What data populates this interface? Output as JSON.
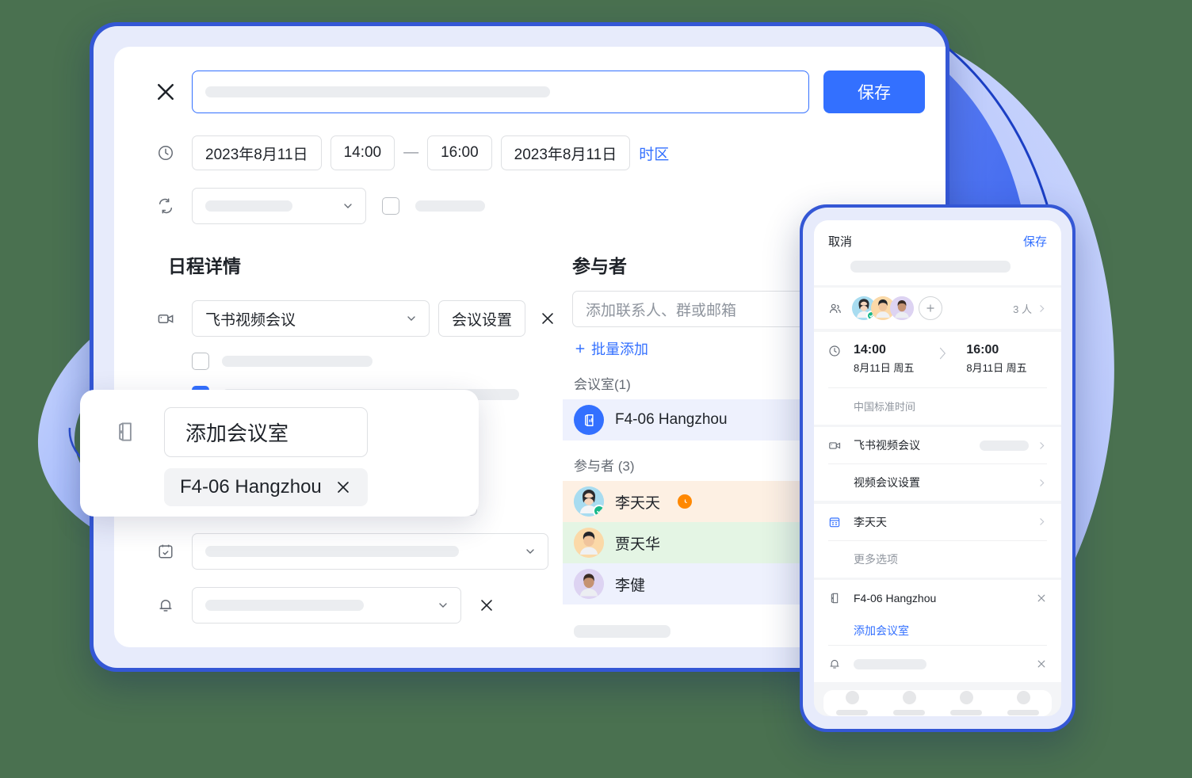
{
  "background_color": "#4a7150",
  "accent_color": "#3370ff",
  "device_frame_color": "#3457d5",
  "tablet": {
    "close_icon": "close-icon",
    "title_placeholder": "",
    "save_label": "保存",
    "datetime": {
      "clock_icon": "clock-icon",
      "start_date": "2023年8月11日",
      "start_time": "14:00",
      "separator": "—",
      "end_time": "16:00",
      "end_date": "2023年8月11日",
      "timezone_label": "时区"
    },
    "repeat": {
      "repeat_icon": "repeat-icon",
      "value": "",
      "checkbox_checked": false,
      "checkbox_label": ""
    },
    "details": {
      "section_title": "日程详情",
      "video_icon": "video-camera-icon",
      "meeting_type": "飞书视频会议",
      "meeting_settings_label": "会议设置",
      "remove_icon": "close-icon",
      "option_1_checked": false,
      "option_1_label": "",
      "option_2_checked": true,
      "option_2_label": "",
      "calendar_icon": "calendar-icon",
      "calendar_value": "",
      "bell_icon": "bell-icon",
      "reminder_value": "",
      "reminder_remove_icon": "close-icon"
    },
    "participants": {
      "section_title": "参与者",
      "search_placeholder": "添加联系人、群或邮箱",
      "batch_add_label": "批量添加",
      "batch_add_icon": "plus-icon",
      "rooms_group_label": "会议室(1)",
      "rooms": [
        {
          "name": "F4-06 Hangzhou",
          "icon": "meeting-room-icon",
          "row_color": "#eef1fd"
        }
      ],
      "people_group_label": "参与者 (3)",
      "people": [
        {
          "name": "李天天",
          "status_icon": "pending-clock-icon",
          "accepted": true,
          "row_color": "#fdf0e3",
          "avatar_color": "#a8dcf0"
        },
        {
          "name": "贾天华",
          "status_icon": "",
          "accepted": false,
          "row_color": "#e4f5e4",
          "avatar_color": "#fbd9a8"
        },
        {
          "name": "李健",
          "status_icon": "",
          "accepted": false,
          "row_color": "#eef1fd",
          "avatar_color": "#ddd3f2"
        }
      ]
    }
  },
  "room_popup": {
    "icon": "meeting-room-icon",
    "add_room_label": "添加会议室",
    "room_tag_label": "F4-06 Hangzhou",
    "room_tag_remove_icon": "close-icon"
  },
  "phone": {
    "cancel_label": "取消",
    "save_label": "保存",
    "title_placeholder": "",
    "attendees": {
      "icon": "people-icon",
      "add_icon": "plus-icon",
      "count_label": "3 人",
      "chevron_icon": "chevron-right-icon",
      "avatars": [
        {
          "name": "李天天",
          "accepted": true,
          "avatar_color": "#a8dcf0"
        },
        {
          "name": "贾天华",
          "accepted": false,
          "avatar_color": "#fbd9a8"
        },
        {
          "name": "李健",
          "accepted": false,
          "avatar_color": "#ddd3f2"
        }
      ]
    },
    "time": {
      "icon": "clock-icon",
      "start_time": "14:00",
      "start_date": "8月11日 周五",
      "arrow_icon": "chevron-right-icon",
      "end_time": "16:00",
      "end_date": "8月11日 周五",
      "timezone": "中国标准时间"
    },
    "meeting": {
      "icon": "video-camera-icon",
      "label": "飞书视频会议",
      "value": "",
      "chevron_icon": "chevron-right-icon",
      "settings_label": "视频会议设置",
      "settings_chevron_icon": "chevron-right-icon"
    },
    "calendar": {
      "icon": "calendar-icon",
      "label": "李天天",
      "chevron_icon": "chevron-right-icon",
      "more_options_label": "更多选项"
    },
    "room": {
      "icon": "meeting-room-icon",
      "label": "F4-06 Hangzhou",
      "remove_icon": "close-icon",
      "add_room_label": "添加会议室"
    },
    "reminder": {
      "icon": "bell-icon",
      "value": "",
      "remove_icon": "close-icon"
    },
    "nav_items": [
      "",
      "",
      "",
      ""
    ]
  }
}
